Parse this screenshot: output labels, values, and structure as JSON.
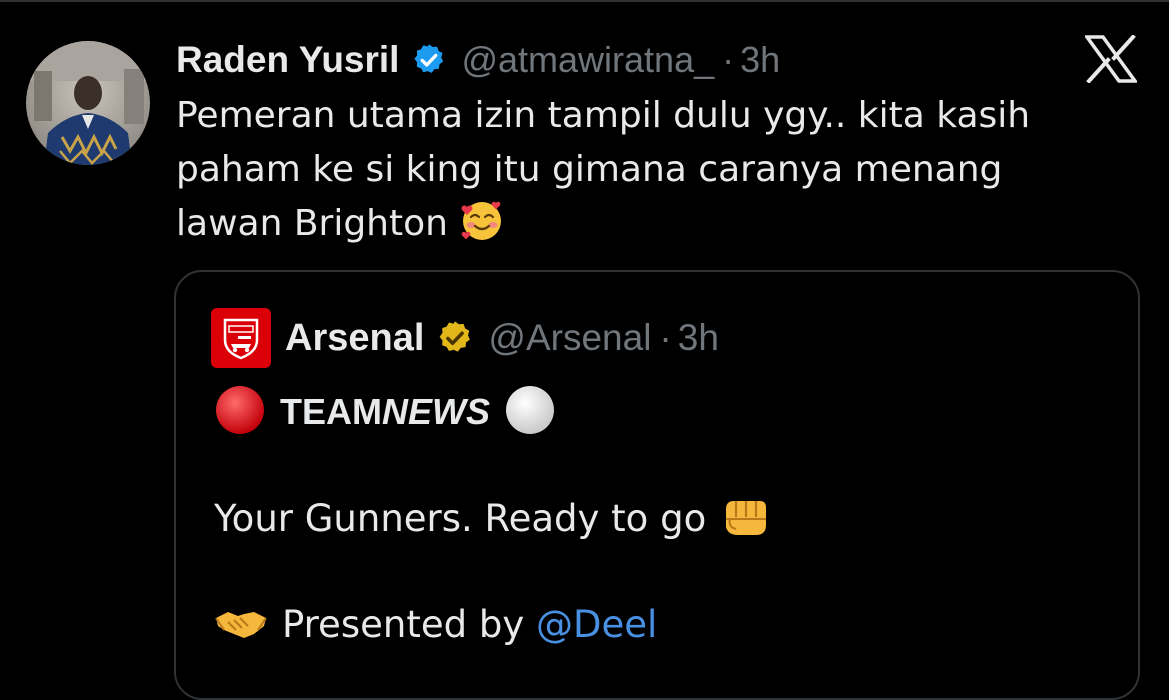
{
  "tweet": {
    "author_name": "Raden Yusril",
    "handle": "@atmawiratna_",
    "separator": "·",
    "time": "3h",
    "text": "Pemeran utama izin tampil dulu ygy.. kita kasih\npaham ke si king itu gimana caranya menang\nlawan Brighton",
    "emoji": "smiling-face-with-hearts",
    "verified_color": "#1d9bf0"
  },
  "close_icon": "x-logo-icon",
  "quoted": {
    "author_name": "Arsenal",
    "handle": "@Arsenal",
    "separator": "·",
    "time": "3h",
    "verified_color": "#e2b719",
    "team_bold": "TEAM",
    "team_italic": "NEWS",
    "line2": "Your Gunners. Ready to go",
    "line3_prefix": "Presented by ",
    "mention": "@Deel",
    "logo_color": "#db0007",
    "mention_color": "#4a90e2"
  }
}
